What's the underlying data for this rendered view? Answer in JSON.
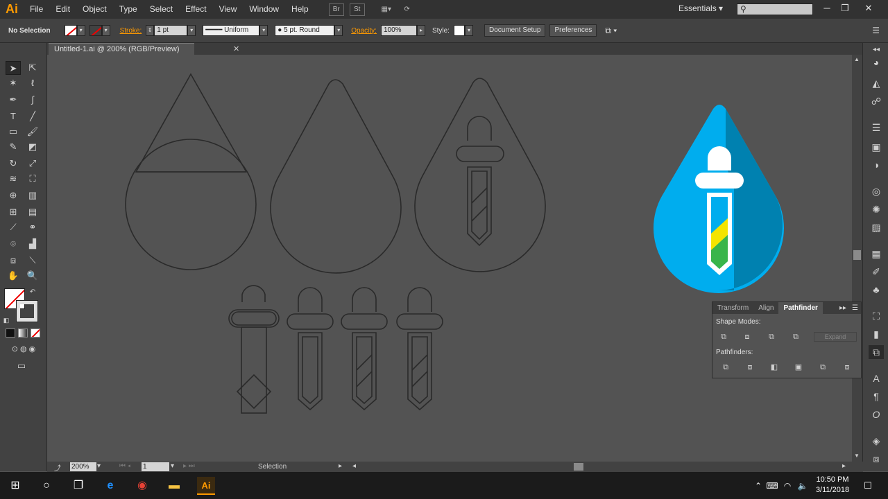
{
  "app": {
    "logo": "Ai",
    "menus": [
      "File",
      "Edit",
      "Object",
      "Type",
      "Select",
      "Effect",
      "View",
      "Window",
      "Help"
    ],
    "bridge_icon": "Br",
    "stock_icon": "St",
    "workspace": "Essentials",
    "search_icon": "search-icon",
    "window_controls": [
      "─",
      "❐",
      "✕"
    ]
  },
  "control_bar": {
    "selection_label": "No Selection",
    "stroke_label": "Stroke:",
    "stroke_weight": "1 pt",
    "profile": "Uniform",
    "brush": "5 pt. Round",
    "opacity_label": "Opacity:",
    "opacity_value": "100%",
    "style_label": "Style:",
    "document_setup": "Document Setup",
    "preferences": "Preferences"
  },
  "document": {
    "tab_title": "Untitled-1.ai @ 200% (RGB/Preview)",
    "close_glyph": "✕"
  },
  "status_bar": {
    "zoom": "200%",
    "artboard": "1",
    "tool_status": "Selection"
  },
  "pathfinder": {
    "tabs": [
      "Transform",
      "Align",
      "Pathfinder"
    ],
    "active_tab": "Pathfinder",
    "shape_modes_label": "Shape Modes:",
    "expand_label": "Expand",
    "pathfinders_label": "Pathfinders:"
  },
  "taskbar": {
    "time": "10:50 PM",
    "date": "3/11/2018",
    "ai_label": "Ai"
  },
  "colors": {
    "drop_blue": "#00adee",
    "drop_shadow": "#0081b0",
    "yellow": "#f4e400",
    "green": "#39b54a",
    "ai_orange": "#ff9a00"
  }
}
